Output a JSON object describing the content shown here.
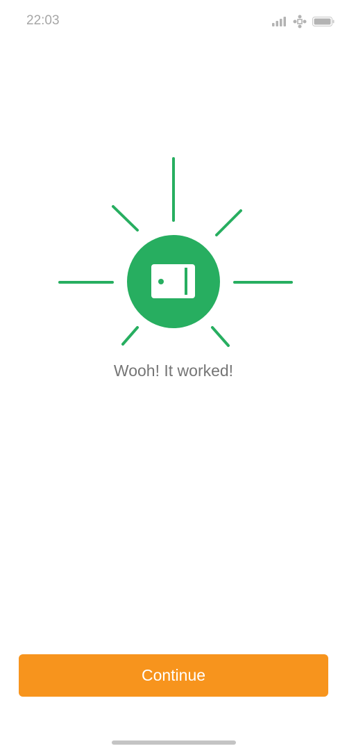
{
  "status_bar": {
    "time": "22:03",
    "icons": [
      "signal-icon",
      "vpn-icon",
      "battery-icon"
    ]
  },
  "illustration": {
    "icon": "wallet-icon",
    "accent_color": "#27ae60"
  },
  "message": "Wooh! It worked!",
  "actions": {
    "continue_label": "Continue",
    "button_color": "#f7941d"
  }
}
